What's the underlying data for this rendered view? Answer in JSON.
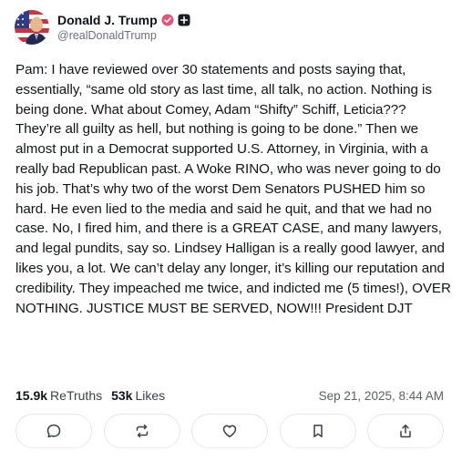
{
  "author": {
    "display_name": "Donald J. Trump",
    "handle": "@realDonaldTrump",
    "avatar_icon": "user-avatar",
    "verified_icon": "verified-badge-icon",
    "follow_icon": "follow-plus-icon",
    "verified_color": "#e0567a"
  },
  "post": {
    "text": "Pam: I have reviewed over 30 statements and posts saying that, essentially, “same old story as last time, all talk, no action. Nothing is being done. What about Comey, Adam “Shifty” Schiff, Leticia??? They’re all guilty as hell, but nothing is going to be done.” Then we almost put in a Democrat supported U.S. Attorney, in Virginia, with a really bad Republican past. A Woke RINO, who was never going to do his job. That’s why two of the worst Dem Senators PUSHED him so hard. He even lied to the media and said he quit, and that we had no case. No, I fired him, and there is a GREAT CASE, and many lawyers, and legal pundits, say so. Lindsey Halligan is a really good lawyer, and likes you, a lot. We can’t delay any longer, it’s killing our reputation and credibility. They impeached me twice, and indicted me (5 times!), OVER NOTHING. JUSTICE MUST BE SERVED, NOW!!! President DJT"
  },
  "stats": {
    "retruths_count": "15.9k",
    "retruths_label": "ReTruths",
    "likes_count": "53k",
    "likes_label": "Likes",
    "timestamp": "Sep 21, 2025, 8:44 AM"
  },
  "actions": [
    {
      "name": "reply-button",
      "icon": "comment-icon"
    },
    {
      "name": "retruth-button",
      "icon": "repost-icon"
    },
    {
      "name": "like-button",
      "icon": "heart-icon"
    },
    {
      "name": "bookmark-button",
      "icon": "bookmark-icon"
    },
    {
      "name": "share-button",
      "icon": "share-icon"
    }
  ]
}
